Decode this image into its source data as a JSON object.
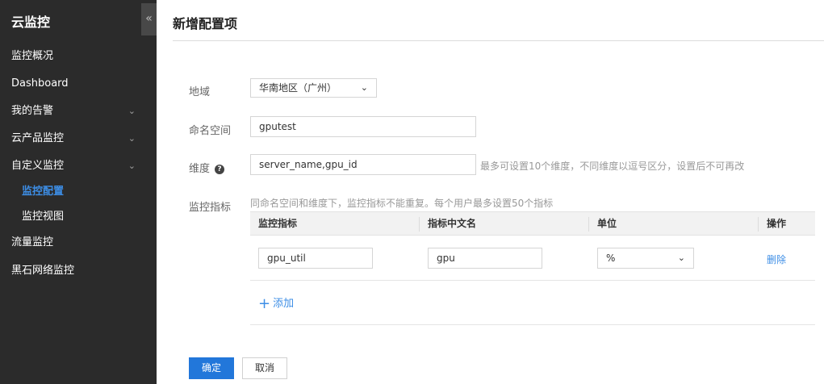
{
  "sidebar": {
    "brand": "云监控",
    "collapse_icon": "«",
    "items": [
      {
        "label": "监控概况",
        "has_chevron": false
      },
      {
        "label": "Dashboard",
        "has_chevron": false
      },
      {
        "label": "我的告警",
        "has_chevron": true
      },
      {
        "label": "云产品监控",
        "has_chevron": true
      },
      {
        "label": "自定义监控",
        "has_chevron": true
      }
    ],
    "sub_items": [
      {
        "label": "监控配置",
        "active": true
      },
      {
        "label": "监控视图",
        "active": false
      }
    ],
    "items_after": [
      {
        "label": "流量监控"
      },
      {
        "label": "黑石网络监控"
      }
    ],
    "chevron_icon": "⌄"
  },
  "page": {
    "title": "新增配置项"
  },
  "form": {
    "region": {
      "label": "地域",
      "value": "华南地区（广州）",
      "arrow": "⌄"
    },
    "namespace": {
      "label": "命名空间",
      "value": "gputest"
    },
    "dimension": {
      "label": "维度",
      "help_icon": "?",
      "value": "server_name,gpu_id",
      "hint": "最多可设置10个维度，不同维度以逗号区分，设置后不可再改"
    },
    "metrics": {
      "label": "监控指标",
      "hint": "同命名空间和维度下，监控指标不能重复。每个用户最多设置50个指标",
      "columns": [
        "监控指标",
        "指标中文名",
        "单位",
        "操作"
      ],
      "rows": [
        {
          "metric": "gpu_util",
          "cn_name": "gpu",
          "unit": "%",
          "action": "删除"
        }
      ],
      "add_label": "添加",
      "add_icon": "+"
    }
  },
  "buttons": {
    "confirm": "确定",
    "cancel": "取消"
  },
  "colors": {
    "sidebar_bg": "#2b2b2b",
    "accent": "#2277da",
    "link": "#3d8ee6"
  }
}
